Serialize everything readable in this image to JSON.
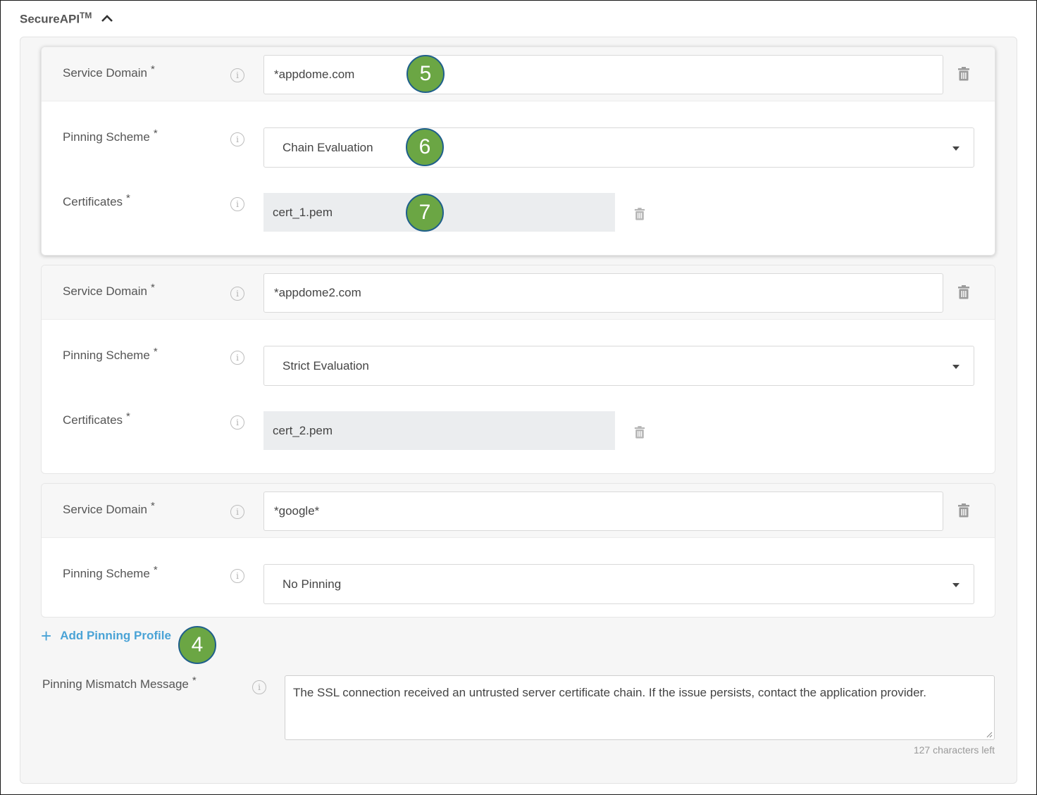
{
  "section": {
    "title": "SecureAPI",
    "trademark": "TM",
    "toggle_icon": "chevron-up-icon"
  },
  "profiles": [
    {
      "service_domain_label": "Service Domain",
      "service_domain_value": "*appdome.com",
      "pinning_scheme_label": "Pinning Scheme",
      "pinning_scheme_value": "Chain Evaluation",
      "certificates_label": "Certificates",
      "certificate_value": "cert_1.pem"
    },
    {
      "service_domain_label": "Service Domain",
      "service_domain_value": "*appdome2.com",
      "pinning_scheme_label": "Pinning Scheme",
      "pinning_scheme_value": "Strict Evaluation",
      "certificates_label": "Certificates",
      "certificate_value": "cert_2.pem"
    },
    {
      "service_domain_label": "Service Domain",
      "service_domain_value": "*google*",
      "pinning_scheme_label": "Pinning Scheme",
      "pinning_scheme_value": "No Pinning"
    }
  ],
  "required_marker": "*",
  "add_profile": {
    "icon": "+",
    "label": "Add Pinning Profile"
  },
  "mismatch": {
    "label": "Pinning Mismatch Message",
    "value": "The SSL connection received an untrusted server certificate chain. If the issue persists, contact the application provider.",
    "counter": "127 characters left"
  },
  "callouts": [
    "5",
    "6",
    "7",
    "4"
  ],
  "colors": {
    "accent": "#4aa3d6",
    "callout_fill": "#6ba644",
    "callout_border": "#1f5f8b"
  }
}
